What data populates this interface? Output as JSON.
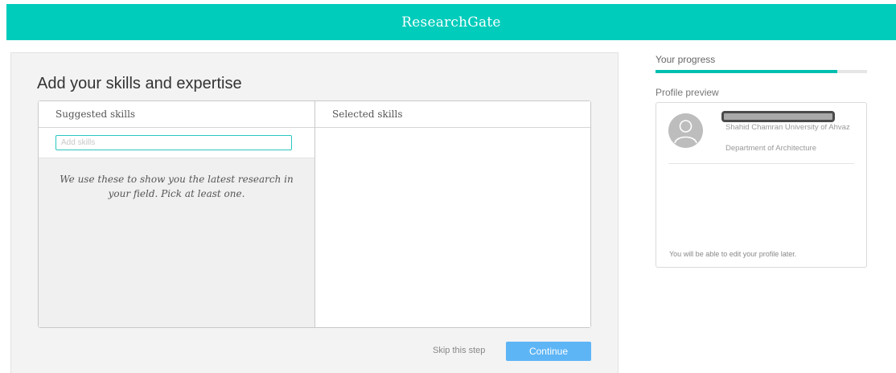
{
  "header": {
    "brand": "ResearchGate"
  },
  "main": {
    "title": "Add your skills and expertise",
    "suggested_header": "Suggested skills",
    "selected_header": "Selected skills",
    "input_value": "",
    "input_placeholder": "Add skills",
    "hint": "We use these to show you the latest research in your field. Pick at least one.",
    "skip_label": "Skip this step",
    "continue_label": "Continue"
  },
  "sidebar": {
    "progress_label": "Your progress",
    "progress_fraction": 0.86,
    "preview_label": "Profile preview",
    "profile": {
      "institution": "Shahid Chamran University of Ahvaz",
      "department": "Department of Architecture"
    },
    "edit_note": "You will be able to edit your profile later."
  },
  "colors": {
    "brand": "#00ccbb",
    "continue_button": "#5eb5f6",
    "progress": "#00bfae"
  },
  "icons": {
    "avatar": "default-user-silhouette-icon"
  }
}
